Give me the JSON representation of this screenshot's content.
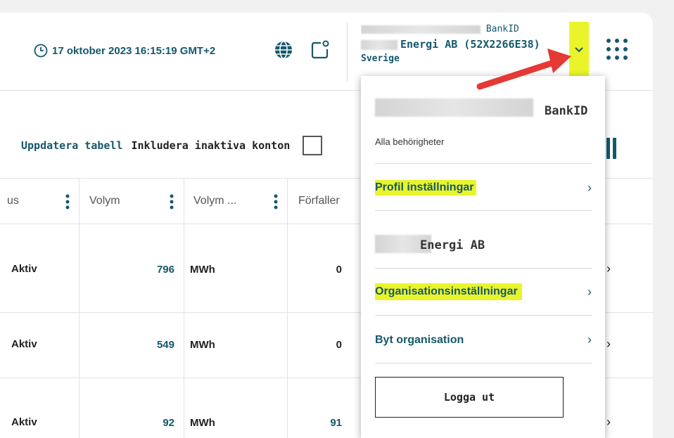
{
  "header": {
    "datetime": "17 oktober 2023 16:15:19 GMT+2",
    "user_line1_suffix": "BankID",
    "user_org_line": "Energi AB (52X2266E38)",
    "user_country": "Sverige"
  },
  "toolbar": {
    "update_label": "Uppdatera tabell",
    "include_inactive_label": "Inkludera inaktiva konton"
  },
  "table": {
    "columns": [
      "us",
      "Volym",
      "Volym ...",
      "Förfaller"
    ],
    "rows": [
      {
        "status": "Aktiv",
        "volume": "796",
        "unit": "MWh",
        "due": "0"
      },
      {
        "status": "Aktiv",
        "volume": "549",
        "unit": "MWh",
        "due": "0"
      },
      {
        "status": "Aktiv",
        "volume": "92",
        "unit": "MWh",
        "due": "91"
      }
    ]
  },
  "menu": {
    "user_suffix": "BankID",
    "permissions": "Alla behörigheter",
    "profile_settings": "Profil inställningar",
    "org_name_suffix": "Energi AB",
    "org_settings": "Organisationsinställningar",
    "switch_org": "Byt organisation",
    "logout": "Logga ut"
  },
  "colors": {
    "accent": "#15586b",
    "highlight": "#e9f52a",
    "arrow": "#e53935"
  }
}
